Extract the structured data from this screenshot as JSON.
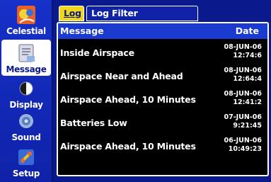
{
  "sidebar": {
    "items": [
      {
        "label": "Celestial",
        "icon": "celestial-icon",
        "active": false
      },
      {
        "label": "Message",
        "icon": "message-icon",
        "active": true
      },
      {
        "label": "Display",
        "icon": "display-icon",
        "active": false
      },
      {
        "label": "Sound",
        "icon": "sound-icon",
        "active": false
      },
      {
        "label": "Setup",
        "icon": "setup-icon",
        "active": false
      }
    ]
  },
  "tabs": [
    {
      "label": "Log",
      "active": true
    },
    {
      "label": "Log Filter",
      "active": false
    }
  ],
  "table": {
    "columns": [
      "Message",
      "Date"
    ],
    "rows": [
      {
        "message": "Inside Airspace",
        "date": "08-JUN-06",
        "time": "12:74:6"
      },
      {
        "message": "Airspace Near and Ahead",
        "date": "08-JUN-06",
        "time": "12:64:4"
      },
      {
        "message": "Airspace Ahead, 10 Minutes",
        "date": "08-JUN-06",
        "time": "12:41:2"
      },
      {
        "message": "Batteries Low",
        "date": "07-JUN-06",
        "time": "9:21:45"
      },
      {
        "message": "Airspace Ahead, 10 Minutes",
        "date": "06-JUN-06",
        "time": "10:49:23"
      }
    ]
  },
  "colors": {
    "background": "#0a1a8c",
    "accent": "#f0d818",
    "header": "#1a3ad0"
  }
}
